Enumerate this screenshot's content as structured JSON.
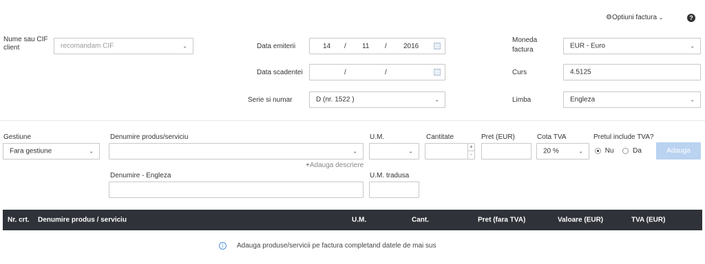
{
  "toolbar": {
    "options_label": "Optiuni factura",
    "help_icon": "help-icon"
  },
  "client": {
    "label": "Nume sau CIF client",
    "placeholder": "recomandam CIF"
  },
  "dates": {
    "emit_label": "Data emiterii",
    "emit_day": "14",
    "emit_month": "11",
    "emit_year": "2016",
    "sep": "/",
    "due_label": "Data scadentei"
  },
  "series": {
    "label": "Serie si numar",
    "value": "D (nr. 1522 )"
  },
  "currency": {
    "label": "Moneda factura",
    "value": "EUR - Euro"
  },
  "rate": {
    "label": "Curs",
    "value": "4.5125"
  },
  "language": {
    "label": "Limba",
    "value": "Engleza"
  },
  "product": {
    "stock_label": "Gestiune",
    "stock_value": "Fara gestiune",
    "name_label": "Denumire produs/serviciu",
    "um_label": "U.M.",
    "qty_label": "Cantitate",
    "price_label": "Pret (EUR)",
    "vat_label": "Cota TVA",
    "vat_value": "20 %",
    "includes_vat_label": "Pretul include TVA?",
    "no_label": "Nu",
    "yes_label": "Da",
    "add_button": "Adauga",
    "add_description": "Adauga descriere",
    "name_en_label": "Denumire - Engleza",
    "um_translated_label": "U.M. tradusa"
  },
  "table": {
    "headers": [
      "Nr. crt.",
      "Denumire produs / serviciu",
      "U.M.",
      "Cant.",
      "Pret (fara TVA)",
      "Valoare (EUR)",
      "TVA (EUR)"
    ],
    "empty_message": "Adauga produse/servicii pe factura completand datele de mai sus"
  },
  "colors": {
    "header_bg": "#2f3238",
    "add_button_bg": "#b9d3f0",
    "info_icon": "#4a90d9"
  }
}
